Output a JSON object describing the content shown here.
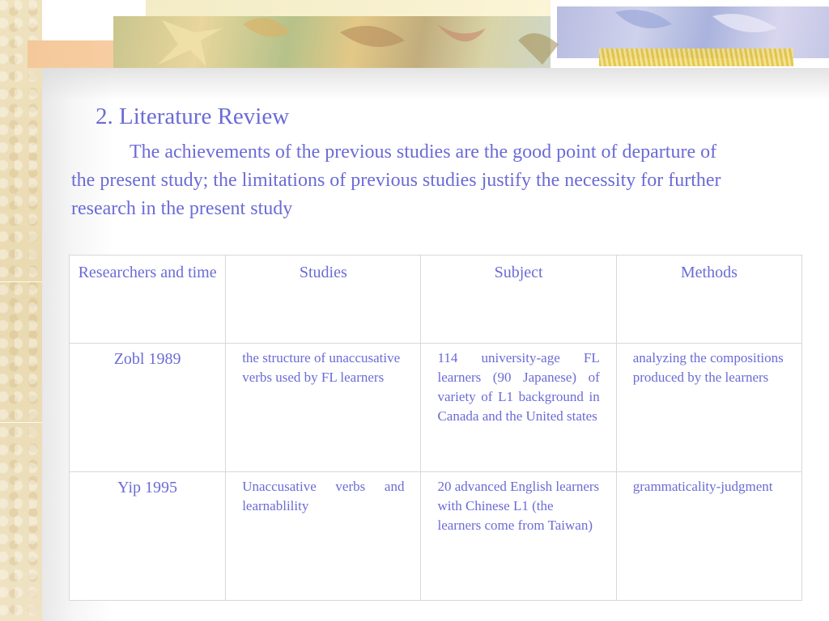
{
  "slide": {
    "title": "2. Literature Review",
    "paragraph_lines": [
      "The achievements of the previous studies are the good point of departure of",
      "the present study; the limitations of previous studies justify the necessity for further",
      "research in the present study"
    ]
  },
  "table": {
    "headers": [
      "Researchers and time",
      "Studies",
      "Subject",
      "Methods"
    ],
    "rows": [
      {
        "researcher": "Zobl 1989",
        "studies": "the structure of unaccusative verbs used by FL learners",
        "subject": "114 university-age FL learners (90 Japanese) of variety of L1 background in Canada and the United states",
        "methods": "analyzing the compositions produced by the learners"
      },
      {
        "researcher": "Yip 1995",
        "studies": "Unaccusative verbs and learnablility",
        "subject": "20 advanced English learners with Chinese L1 (the learners come from Taiwan)",
        "methods": "grammaticality-judgment"
      }
    ]
  },
  "colors": {
    "text": "#6b6bd6",
    "border": "#d8d8d8"
  }
}
